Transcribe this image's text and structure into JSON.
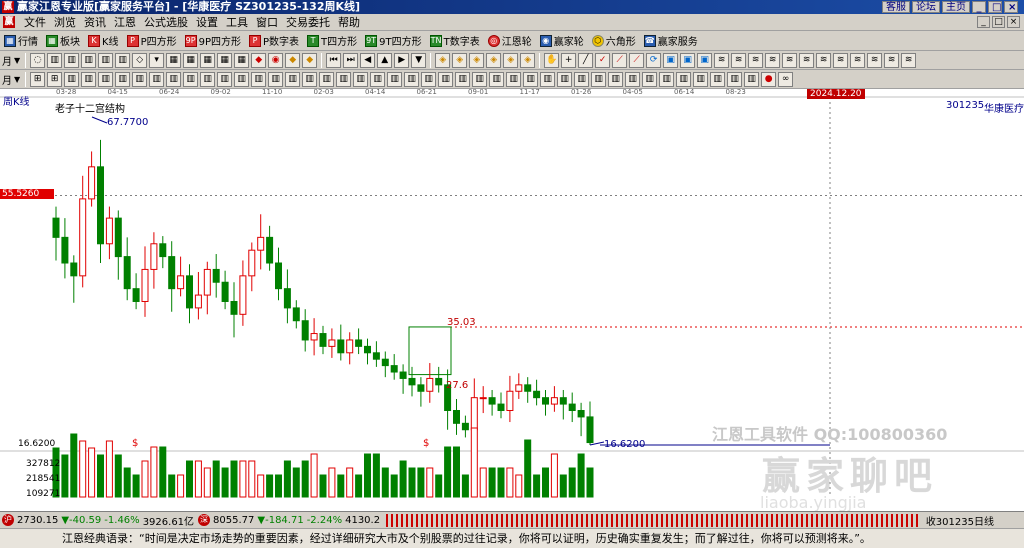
{
  "window": {
    "app_icon": "赢",
    "title": "赢家江恩专业版[赢家服务平台] - [华康医疗  SZ301235-132周K线]",
    "links": [
      "客服",
      "论坛",
      "主页"
    ],
    "controls": [
      "_",
      "□",
      "×"
    ]
  },
  "menubar": {
    "icon": "赢",
    "items": [
      "文件",
      "浏览",
      "资讯",
      "江恩",
      "公式选股",
      "设置",
      "工具",
      "窗口",
      "交易委托",
      "帮助"
    ],
    "mdi_controls": [
      "_",
      "□",
      "×"
    ]
  },
  "toolbar1": [
    {
      "icon": "grid-icon",
      "label": "行情",
      "style": "blue"
    },
    {
      "icon": "grid-icon",
      "label": "板块",
      "style": "green"
    },
    {
      "icon": "kline-icon",
      "label": "K线",
      "style": "red"
    },
    {
      "icon": "P",
      "label": "P四方形",
      "style": "red"
    },
    {
      "icon": "9P",
      "label": "9P四方形",
      "style": "red"
    },
    {
      "icon": "P",
      "label": "P数字表",
      "style": "red"
    },
    {
      "icon": "T",
      "label": "T四方形",
      "style": "green"
    },
    {
      "icon": "9T",
      "label": "9T四方形",
      "style": "green"
    },
    {
      "icon": "TN",
      "label": "T数字表",
      "style": "green"
    },
    {
      "icon": "wheel-icon",
      "label": "江恩轮",
      "style": "red"
    },
    {
      "icon": "wheel-icon",
      "label": "赢家轮",
      "style": "blue"
    },
    {
      "icon": "hexagon-icon",
      "label": "六角形",
      "style": "yellow"
    },
    {
      "icon": "service-icon",
      "label": "赢家服务",
      "style": "blue"
    }
  ],
  "toolbar2": {
    "period_label": "月"
  },
  "chart": {
    "period_label": "周K线",
    "indicator_label": "老子十二宫结构",
    "stock_code": "301235",
    "stock_name": "华康医疗",
    "current_date": "2024.12.20",
    "y_marker_label": "55.5260",
    "high_label": "67.7700",
    "low_label": "16.6200",
    "low_label_left": "16.6200",
    "box_top_label": "35.03",
    "box_bottom_label": "27.6",
    "vol_labels": [
      "327812",
      "218541",
      "109271"
    ],
    "dollar_marks": [
      "$",
      "$"
    ],
    "x_ticks": [
      "03-28",
      "04-15",
      "06-24",
      "09-02",
      "11-10",
      "02-03",
      "04-14",
      "06-21",
      "09-01",
      "11-17",
      "01-26",
      "04-05",
      "06-14",
      "08-23"
    ],
    "watermark_line1": "江恩工具软件  QQ:100800360",
    "watermark_line2": "赢家聊吧",
    "watermark_url": "liaoba.yingjia",
    "colors": {
      "up": "#e00000",
      "down": "#008000",
      "grid": "#808080",
      "marker": "#e00000",
      "label": "#00008b"
    }
  },
  "chart_data": {
    "type": "candlestick",
    "title": "",
    "xlabel": "",
    "ylabel": "",
    "ylim": [
      16.62,
      67.77
    ],
    "high": 67.77,
    "low": 16.62,
    "reference_level": 55.526,
    "box_top": 35.03,
    "box_bottom": 27.6,
    "weekly_closes_approx": [
      49,
      45,
      43,
      55,
      60,
      48,
      52,
      46,
      41,
      39,
      44,
      48,
      46,
      41,
      43,
      38,
      40,
      44,
      42,
      39,
      37,
      43,
      47,
      49,
      45,
      41,
      38,
      36,
      33,
      34,
      32,
      33,
      31,
      33,
      32,
      31,
      30,
      29,
      28,
      27,
      26,
      25,
      27,
      26,
      22,
      20,
      19,
      24,
      24,
      23,
      22,
      25,
      26,
      25,
      24,
      23,
      24,
      23,
      22,
      21,
      17
    ],
    "volume_ticks": [
      327812,
      218541,
      109271
    ]
  },
  "statusbar": {
    "sh_icon": "沪",
    "sh_index": "2730.15",
    "sh_change": "▼-40.59",
    "sh_pct": "-1.46%",
    "sh_amount": "3926.61亿",
    "sz_icon": "深",
    "sz_index": "8055.77",
    "sz_change": "▼-184.71",
    "sz_pct": "-2.24%",
    "sz_amount": "4130.2",
    "right_text": "收301235日线"
  },
  "quotebar": {
    "text": "江恩经典语录：“时间是决定市场走势的重要因素，经过详细研究大市及个别股票的过往记录，你将可以证明，历史确实重复发生；而了解过往，你将可以预测将来。”。"
  }
}
